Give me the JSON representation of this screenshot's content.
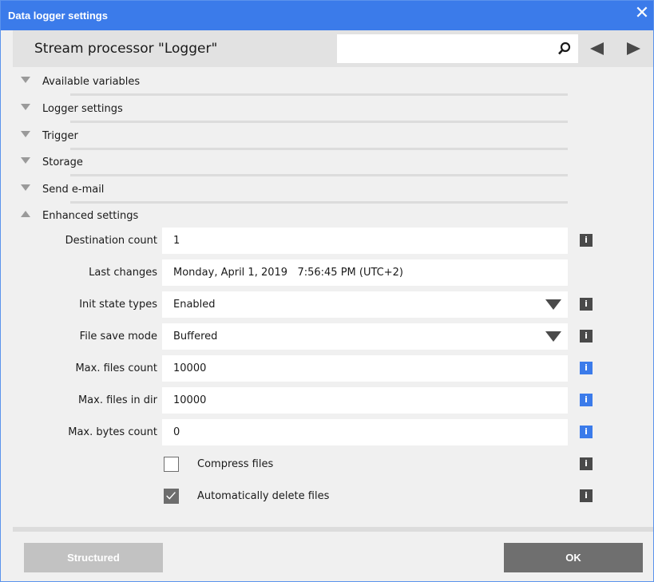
{
  "window": {
    "title": "Data logger settings",
    "close_glyph": "✕"
  },
  "header": {
    "heading": "Stream processor \"Logger\"",
    "search_value": "",
    "search_placeholder": ""
  },
  "sections": [
    {
      "label": "Available variables",
      "expanded": false
    },
    {
      "label": "Logger settings",
      "expanded": false
    },
    {
      "label": "Trigger",
      "expanded": false
    },
    {
      "label": "Storage",
      "expanded": false
    },
    {
      "label": "Send e-mail",
      "expanded": false
    },
    {
      "label": "Enhanced settings",
      "expanded": true
    }
  ],
  "enhanced": {
    "destination_count": {
      "label": "Destination count",
      "value": "1",
      "info": "i"
    },
    "last_changes": {
      "label": "Last changes",
      "value": "Monday, April 1, 2019   7:56:45 PM (UTC+2)"
    },
    "init_state_types": {
      "label": "Init state types",
      "value": "Enabled",
      "info": "i"
    },
    "file_save_mode": {
      "label": "File save mode",
      "value": "Buffered",
      "info": "i"
    },
    "max_files_count": {
      "label": "Max. files count",
      "value": "10000",
      "info": "i"
    },
    "max_files_in_dir": {
      "label": "Max. files in dir",
      "value": "10000",
      "info": "i"
    },
    "max_bytes_count": {
      "label": "Max. bytes count",
      "value": "0",
      "info": "i"
    },
    "compress_files": {
      "label": "Compress files",
      "checked": false,
      "info": "i"
    },
    "auto_delete": {
      "label": "Automatically delete files",
      "checked": true,
      "info": "i"
    }
  },
  "footer": {
    "structured_label": "Structured",
    "ok_label": "OK"
  },
  "colors": {
    "title_bar": "#3b7bea",
    "info_dark": "#4a4a4a",
    "info_blue": "#3b7bea",
    "button_ok": "#6f6f6f",
    "button_disabled": "#c2c2c2"
  }
}
